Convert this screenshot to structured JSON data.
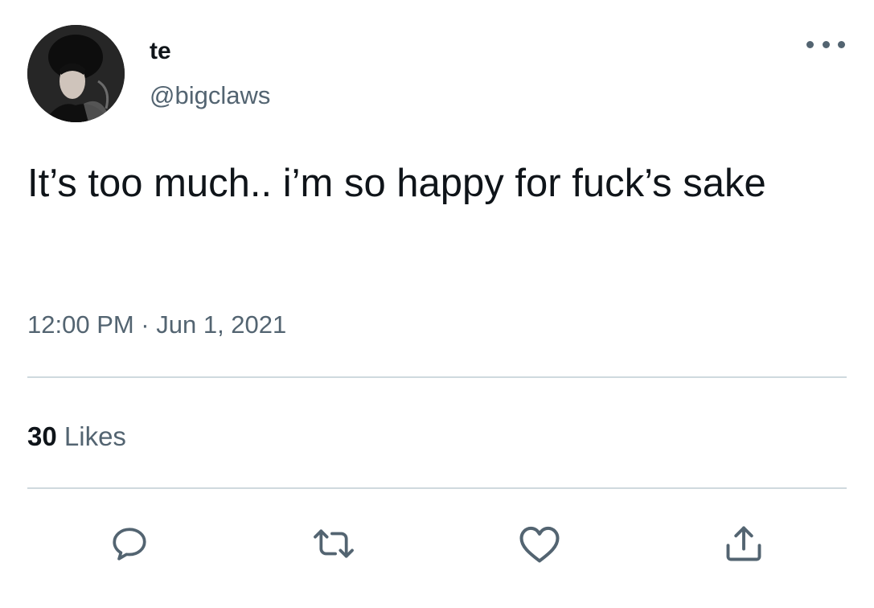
{
  "author": {
    "display_name": "te",
    "handle": "@bigclaws",
    "avatar_icon": "profile-photo"
  },
  "tweet": {
    "text": "It’s too much.. i’m so happy for fuck’s sake",
    "timestamp": "12:00 PM · Jun 1, 2021"
  },
  "stats": {
    "likes_count": "30",
    "likes_label": "Likes"
  },
  "actions": {
    "reply_icon": "reply-icon",
    "retweet_icon": "retweet-icon",
    "like_icon": "heart-icon",
    "share_icon": "share-icon"
  },
  "colors": {
    "text_primary": "#0f1419",
    "text_secondary": "#536471",
    "divider": "#cfd9de",
    "background": "#ffffff"
  }
}
